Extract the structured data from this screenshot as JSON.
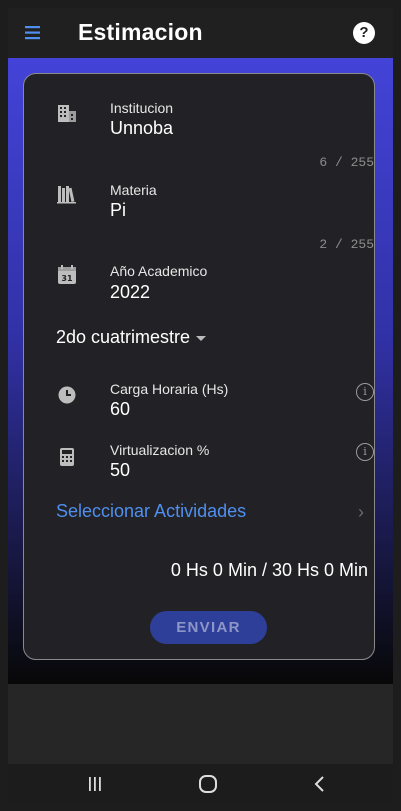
{
  "appbar": {
    "title": "Estimacion",
    "help_symbol": "?"
  },
  "form": {
    "institucion": {
      "label": "Institucion",
      "value": "Unnoba",
      "counter": "6 / 255"
    },
    "materia": {
      "label": "Materia",
      "value": "Pi",
      "counter": "2 / 255"
    },
    "anio": {
      "label": "Año Academico",
      "value": "2022"
    },
    "semester": {
      "value": "2do cuatrimestre"
    },
    "carga": {
      "label": "Carga Horaria (Hs)",
      "value": "60"
    },
    "virtualizacion": {
      "label": "Virtualizacion %",
      "value": "50"
    },
    "select_activities": "Seleccionar Actividades",
    "total": "0 Hs 0 Min / 30 Hs 0 Min",
    "send": "ENVIAR"
  },
  "icons": {
    "menu": "menu-icon",
    "help": "help-icon",
    "institution": "building-icon",
    "subject": "books-icon",
    "calendar": "calendar-icon",
    "clock": "clock-icon",
    "calculator": "calculator-icon",
    "info": "info-icon",
    "chevron": "chevron-right-icon",
    "nav_recent": "recent-apps-icon",
    "nav_home": "home-icon",
    "nav_back": "back-icon"
  },
  "colors": {
    "accent_blue": "#4f8ff0",
    "gradient_top": "#4343d8",
    "button_bg": "#2e3f9a",
    "card_bg": "#222226"
  },
  "calendar_day": "31"
}
